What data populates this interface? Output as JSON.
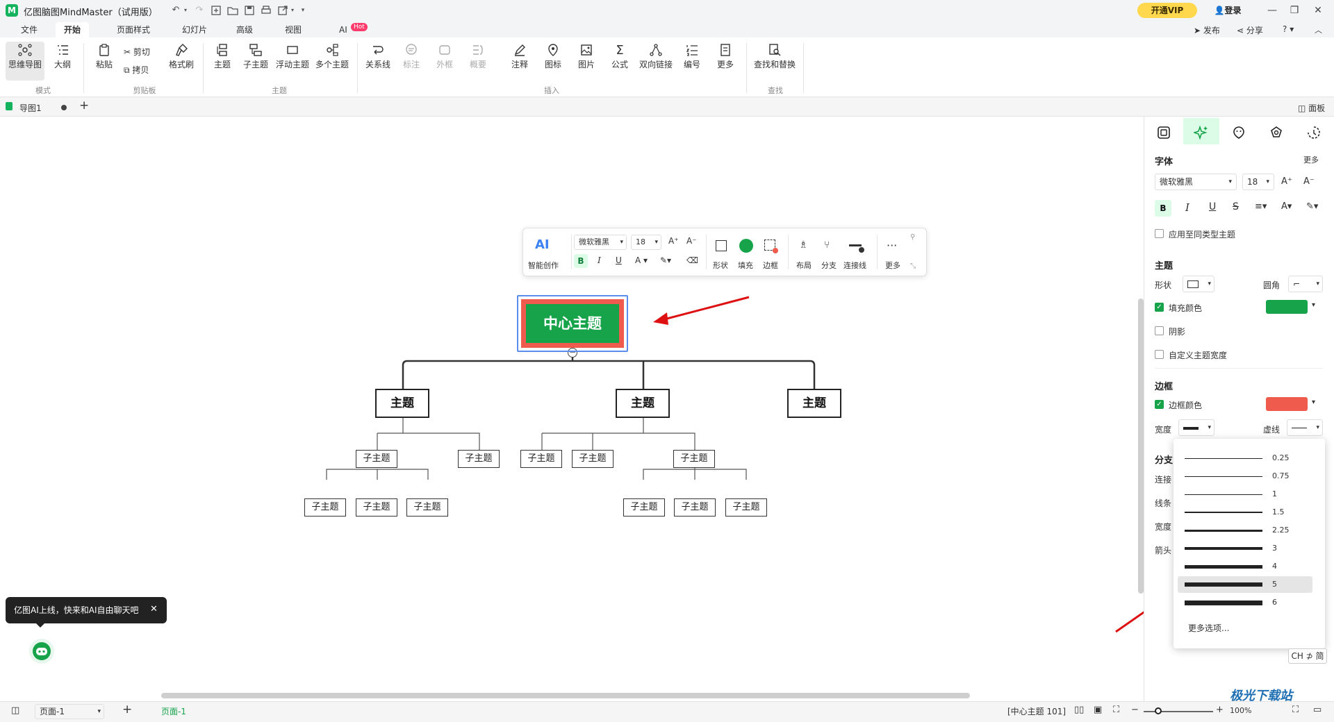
{
  "titlebar": {
    "app_title": "亿图脑图MindMaster（试用版）",
    "vip_label": "开通VIP",
    "login_label": "登录"
  },
  "menu": {
    "tabs": [
      "文件",
      "开始",
      "页面样式",
      "幻灯片",
      "高级",
      "视图",
      "AI"
    ],
    "ai_badge": "Hot",
    "right_tools": {
      "publish": "发布",
      "share": "分享",
      "help": "?"
    }
  },
  "ribbon": {
    "mode": {
      "mindmap": "思维导图",
      "outline": "大纲",
      "group": "模式"
    },
    "clipboard": {
      "paste": "粘贴",
      "cut": "剪切",
      "copy": "拷贝",
      "format_painter": "格式刷",
      "group": "剪贴板"
    },
    "topic": {
      "main": "主题",
      "sub": "子主题",
      "floating": "浮动主题",
      "multi": "多个主题",
      "group": "主题"
    },
    "insert": {
      "relation": "关系线",
      "callout": "标注",
      "boundary": "外框",
      "summary": "概要",
      "note": "注释",
      "icon": "图标",
      "picture": "图片",
      "formula": "公式",
      "link": "双向链接",
      "number": "编号",
      "more": "更多",
      "group": "插入"
    },
    "find": {
      "find_replace": "查找和替换",
      "group": "查找"
    }
  },
  "doctabs": {
    "tab": "导图1",
    "panel_toggle": "面板"
  },
  "float_toolbar": {
    "ai_label": "AI",
    "ai_create": "智能创作",
    "font": "微软雅黑",
    "size": "18",
    "shape": "形状",
    "fill": "填充",
    "border": "边框",
    "layout": "布局",
    "branch": "分支",
    "connector": "连接线",
    "more": "更多"
  },
  "mindmap": {
    "central": "中心主题",
    "topics": [
      "主题",
      "主题",
      "主题"
    ],
    "subtopic_label": "子主题"
  },
  "panel": {
    "font_section": "字体",
    "more": "更多",
    "font_name": "微软雅黑",
    "font_size": "18",
    "apply_same": "应用至同类型主题",
    "topic_section": "主题",
    "shape_label": "形状",
    "corner_label": "圆角",
    "fill_color_label": "填充颜色",
    "shadow_label": "阴影",
    "custom_width_label": "自定义主题宽度",
    "border_section": "边框",
    "border_color_label": "边框颜色",
    "width_label": "宽度",
    "dash_label": "虚线",
    "branch_section": "分支",
    "branch_connect": "连接",
    "branch_line": "线条",
    "branch_width": "宽度",
    "branch_arrow": "箭头",
    "fill_color": "#16a34a",
    "border_color": "#ef5b4c"
  },
  "width_dropdown": {
    "options": [
      "0.25",
      "0.75",
      "1",
      "1.5",
      "2.25",
      "3",
      "4",
      "5",
      "6"
    ],
    "selected": "5",
    "more_options": "更多选项..."
  },
  "ai_tip": "亿图AI上线，快来和AI自由聊天吧",
  "ime": "CH ⊅ 简",
  "statusbar": {
    "page_select": "页面-1",
    "page_tab": "页面-1",
    "selection_info": "[中心主题 101]",
    "zoom": "100%"
  },
  "watermark": "极光下载站"
}
